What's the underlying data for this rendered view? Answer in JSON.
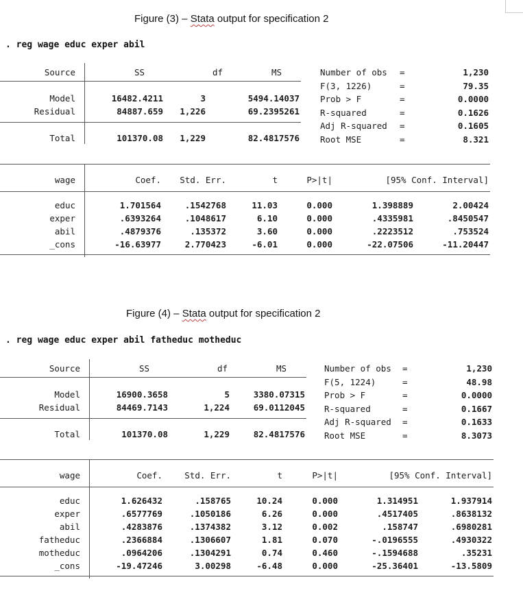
{
  "figures": [
    {
      "caption_prefix": "Figure (3) – ",
      "caption_squiggle": "Stata",
      "caption_suffix": " output for specification 2",
      "command": ". reg wage educ exper abil",
      "anova": {
        "headers": [
          "Source",
          "SS",
          "df",
          "MS"
        ],
        "rows": [
          {
            "source": "Model",
            "ss": "16482.4211",
            "df": "3",
            "ms": "5494.14037"
          },
          {
            "source": "Residual",
            "ss": "84887.659",
            "df": "1,226",
            "ms": "69.2395261"
          }
        ],
        "total": {
          "source": "Total",
          "ss": "101370.08",
          "df": "1,229",
          "ms": "82.4817576"
        }
      },
      "stats": [
        {
          "label": "Number of obs",
          "eq": "=",
          "value": "1,230"
        },
        {
          "label": "F(3, 1226)",
          "eq": "=",
          "value": "79.35"
        },
        {
          "label": "Prob > F",
          "eq": "=",
          "value": "0.0000"
        },
        {
          "label": "R-squared",
          "eq": "=",
          "value": "0.1626"
        },
        {
          "label": "Adj R-squared",
          "eq": "=",
          "value": "0.1605"
        },
        {
          "label": "Root MSE",
          "eq": "=",
          "value": "8.321"
        }
      ],
      "coef": {
        "headers": {
          "var": "wage",
          "coef": "Coef.",
          "se": "Std. Err.",
          "t": "t",
          "p": "P>|t|",
          "ci": "[95% Conf. Interval]"
        },
        "rows": [
          {
            "var": "educ",
            "coef": "1.701564",
            "se": ".1542768",
            "t": "11.03",
            "p": "0.000",
            "lo": "1.398889",
            "hi": "2.00424"
          },
          {
            "var": "exper",
            "coef": ".6393264",
            "se": ".1048617",
            "t": "6.10",
            "p": "0.000",
            "lo": ".4335981",
            "hi": ".8450547"
          },
          {
            "var": "abil",
            "coef": ".4879376",
            "se": ".135372",
            "t": "3.60",
            "p": "0.000",
            "lo": ".2223512",
            "hi": ".753524"
          },
          {
            "var": "_cons",
            "coef": "-16.63977",
            "se": "2.770423",
            "t": "-6.01",
            "p": "0.000",
            "lo": "-22.07506",
            "hi": "-11.20447"
          }
        ]
      }
    },
    {
      "caption_prefix": "Figure (4) – ",
      "caption_squiggle": "Stata",
      "caption_suffix": " output for specification 2",
      "command": ". reg wage educ exper abil fatheduc motheduc",
      "anova": {
        "headers": [
          "Source",
          "SS",
          "df",
          "MS"
        ],
        "rows": [
          {
            "source": "Model",
            "ss": "16900.3658",
            "df": "5",
            "ms": "3380.07315"
          },
          {
            "source": "Residual",
            "ss": "84469.7143",
            "df": "1,224",
            "ms": "69.0112045"
          }
        ],
        "total": {
          "source": "Total",
          "ss": "101370.08",
          "df": "1,229",
          "ms": "82.4817576"
        }
      },
      "stats": [
        {
          "label": "Number of obs",
          "eq": "=",
          "value": "1,230"
        },
        {
          "label": "F(5, 1224)",
          "eq": "=",
          "value": "48.98"
        },
        {
          "label": "Prob > F",
          "eq": "=",
          "value": "0.0000"
        },
        {
          "label": "R-squared",
          "eq": "=",
          "value": "0.1667"
        },
        {
          "label": "Adj R-squared",
          "eq": "=",
          "value": "0.1633"
        },
        {
          "label": "Root MSE",
          "eq": "=",
          "value": "8.3073"
        }
      ],
      "coef": {
        "headers": {
          "var": "wage",
          "coef": "Coef.",
          "se": "Std. Err.",
          "t": "t",
          "p": "P>|t|",
          "ci": "[95% Conf. Interval]"
        },
        "rows": [
          {
            "var": "educ",
            "coef": "1.626432",
            "se": ".158765",
            "t": "10.24",
            "p": "0.000",
            "lo": "1.314951",
            "hi": "1.937914"
          },
          {
            "var": "exper",
            "coef": ".6577769",
            "se": ".1050186",
            "t": "6.26",
            "p": "0.000",
            "lo": ".4517405",
            "hi": ".8638132"
          },
          {
            "var": "abil",
            "coef": ".4283876",
            "se": ".1374382",
            "t": "3.12",
            "p": "0.002",
            "lo": ".158747",
            "hi": ".6980281"
          },
          {
            "var": "fatheduc",
            "coef": ".2366884",
            "se": ".1306607",
            "t": "1.81",
            "p": "0.070",
            "lo": "-.0196555",
            "hi": ".4930322"
          },
          {
            "var": "motheduc",
            "coef": ".0964206",
            "se": ".1304291",
            "t": "0.74",
            "p": "0.460",
            "lo": "-.1594688",
            "hi": ".35231"
          },
          {
            "var": "_cons",
            "coef": "-19.47246",
            "se": "3.00298",
            "t": "-6.48",
            "p": "0.000",
            "lo": "-25.36401",
            "hi": "-13.5809"
          }
        ]
      }
    }
  ]
}
